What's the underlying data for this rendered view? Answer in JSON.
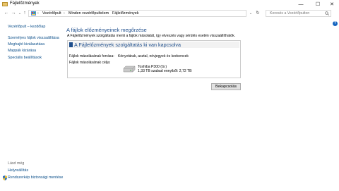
{
  "window": {
    "title": "Fájlelőzmények",
    "minimize": "—",
    "maximize": "☐",
    "close": "✕"
  },
  "address": {
    "nav_back": "←",
    "nav_forward": "→",
    "nav_up": "↑",
    "nav_recent": "⌄",
    "crumbs": [
      "Vezérlőpult",
      "Minden vezérlőpultelem",
      "Fájlelőzmények"
    ],
    "separator": "›",
    "search_placeholder": "Keresés a Vezérlőpulton"
  },
  "sidebar": {
    "home_link": "Vezérlőpult – kezdőlap",
    "items": [
      "Személyes fájlok visszaállítása",
      "Meghajtó kiválasztása",
      "Mappák kizárása",
      "Speciális beállítások"
    ],
    "see_also_label": "Lásd még",
    "see_also": [
      "Helyreállítás",
      "Rendszerkép biztonsági mentése"
    ]
  },
  "main": {
    "heading": "A fájlok előzményeinek megőrzése",
    "description": "A Fájlelőzmények szolgáltatás menti a fájlok másolatát, így elveszés vagy sérülés esetén visszaállíthatók.",
    "status_title": "A Fájlelőzmények szolgáltatás ki van kapcsolva",
    "source_label": "Fájlok másolásának forrása:",
    "source_value": "Könyvtárak, asztal, névjegyek és kedvencek",
    "target_label": "Fájlok másolásának célja:",
    "drive_name": "Toshiba P300 (G:)",
    "drive_space": "1,33 TB szabad ennyiből: 2,72 TB",
    "enable_button": "Bekapcsolás"
  },
  "colors": {
    "link": "#0b4f8a",
    "heading": "#1e4e8c"
  }
}
